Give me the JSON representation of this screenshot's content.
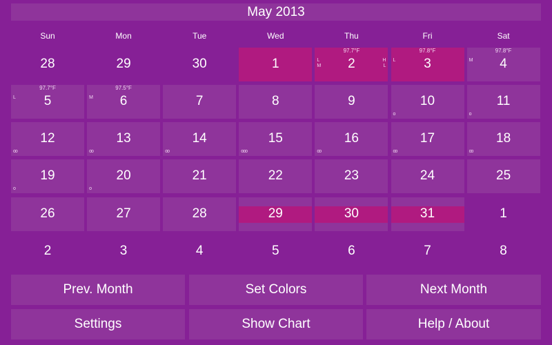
{
  "header": {
    "title": "May 2013"
  },
  "weekdays": [
    "Sun",
    "Mon",
    "Tue",
    "Wed",
    "Thu",
    "Fri",
    "Sat"
  ],
  "colors": {
    "background": "#862096",
    "cell": "#8f349b",
    "highlight": "#b01a80",
    "text": "#ffffff"
  },
  "days": [
    {
      "n": "28",
      "type": "out"
    },
    {
      "n": "29",
      "type": "out"
    },
    {
      "n": "30",
      "type": "out"
    },
    {
      "n": "1",
      "type": "hl"
    },
    {
      "n": "2",
      "type": "hl",
      "temp": "97.7°F",
      "left": "L\nM",
      "right": "H\nL"
    },
    {
      "n": "3",
      "type": "hl",
      "temp": "97.8°F",
      "left": "L"
    },
    {
      "n": "4",
      "type": "cur",
      "temp": "97.8°F",
      "left": "M"
    },
    {
      "n": "5",
      "type": "cur",
      "temp": "97.7°F",
      "left": "L"
    },
    {
      "n": "6",
      "type": "cur",
      "temp": "97.5°F",
      "left": "M"
    },
    {
      "n": "7",
      "type": "cur"
    },
    {
      "n": "8",
      "type": "cur"
    },
    {
      "n": "9",
      "type": "cur"
    },
    {
      "n": "10",
      "type": "cur",
      "dots": "o"
    },
    {
      "n": "11",
      "type": "cur",
      "dots": "o"
    },
    {
      "n": "12",
      "type": "cur",
      "dots": "oo"
    },
    {
      "n": "13",
      "type": "cur",
      "dots": "oo"
    },
    {
      "n": "14",
      "type": "cur",
      "dots": "oo"
    },
    {
      "n": "15",
      "type": "cur",
      "dots": "ooo"
    },
    {
      "n": "16",
      "type": "cur",
      "dots": "oo"
    },
    {
      "n": "17",
      "type": "cur",
      "dots": "oo"
    },
    {
      "n": "18",
      "type": "cur",
      "dots": "oo"
    },
    {
      "n": "19",
      "type": "cur",
      "dots": "o"
    },
    {
      "n": "20",
      "type": "cur",
      "dots": "o"
    },
    {
      "n": "21",
      "type": "cur"
    },
    {
      "n": "22",
      "type": "cur"
    },
    {
      "n": "23",
      "type": "cur"
    },
    {
      "n": "24",
      "type": "cur"
    },
    {
      "n": "25",
      "type": "cur"
    },
    {
      "n": "26",
      "type": "cur"
    },
    {
      "n": "27",
      "type": "cur"
    },
    {
      "n": "28",
      "type": "cur"
    },
    {
      "n": "29",
      "type": "band"
    },
    {
      "n": "30",
      "type": "band"
    },
    {
      "n": "31",
      "type": "band"
    },
    {
      "n": "1",
      "type": "out"
    },
    {
      "n": "2",
      "type": "out"
    },
    {
      "n": "3",
      "type": "out"
    },
    {
      "n": "4",
      "type": "out"
    },
    {
      "n": "5",
      "type": "out"
    },
    {
      "n": "6",
      "type": "out"
    },
    {
      "n": "7",
      "type": "out"
    },
    {
      "n": "8",
      "type": "out"
    }
  ],
  "buttons": {
    "prev_month": "Prev. Month",
    "set_colors": "Set Colors",
    "next_month": "Next Month",
    "settings": "Settings",
    "show_chart": "Show Chart",
    "help_about": "Help / About"
  }
}
